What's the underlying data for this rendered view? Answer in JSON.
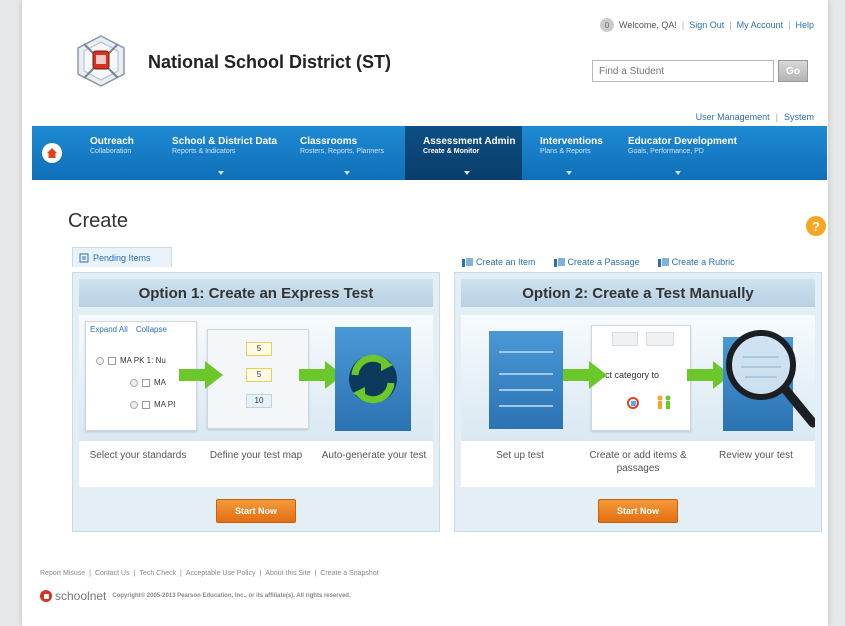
{
  "header": {
    "avatar_text": "0",
    "welcome": "Welcome, QA!",
    "sign_out": "Sign Out",
    "my_account": "My Account",
    "help": "Help",
    "district_name": "National School District (ST)",
    "search_placeholder": "Find a Student",
    "go_label": "Go",
    "user_management": "User Management",
    "system": "System"
  },
  "nav": {
    "items": [
      {
        "title": "Outreach",
        "subtitle": "Collaboration",
        "has_caret": false
      },
      {
        "title": "School & District Data",
        "subtitle": "Reports & Indicators",
        "has_caret": true
      },
      {
        "title": "Classrooms",
        "subtitle": "Rosters, Reports, Planners",
        "has_caret": true
      },
      {
        "title": "Assessment Admin",
        "subtitle": "Create & Monitor",
        "has_caret": true,
        "active": true
      },
      {
        "title": "Interventions",
        "subtitle": "Plans & Reports",
        "has_caret": true
      },
      {
        "title": "Educator Development",
        "subtitle": "Goals, Performance, PD",
        "has_caret": true
      }
    ]
  },
  "page": {
    "title": "Create",
    "help_icon": "?",
    "pending_tab": "Pending Items",
    "create_links": [
      "Create an Item",
      "Create a Passage",
      "Create a Rubric"
    ]
  },
  "option1": {
    "heading": "Option 1: Create an Express Test",
    "expand_all": "Expand All",
    "collapse": "Collapse",
    "tree": [
      "MA PK 1: Nu",
      "MA",
      "MA PI"
    ],
    "numbers": [
      "5",
      "5",
      "10"
    ],
    "steps": [
      "Select your standards",
      "Define your test map",
      "Auto-generate your test"
    ],
    "button": "Start Now"
  },
  "option2": {
    "heading": "Option 2: Create a Test Manually",
    "category_text": "lect category to",
    "steps": [
      "Set up test",
      "Create or add items & passages",
      "Review your test"
    ],
    "button": "Start Now"
  },
  "footer": {
    "links": [
      "Report Misuse",
      "Contact Us",
      "Tech Check",
      "Acceptable Use Policy",
      "About this Site",
      "Create a Snapshot"
    ],
    "brand": "schoolnet",
    "copyright": "Copyright© 2005-2013 Pearson Education, Inc., or its affiliate(s). All rights reserved."
  },
  "colors": {
    "nav_blue": "#1f8ad2",
    "nav_active": "#0d4f84",
    "button_orange": "#e46e12",
    "link_blue": "#2a70b0",
    "help_orange": "#f5a623"
  }
}
